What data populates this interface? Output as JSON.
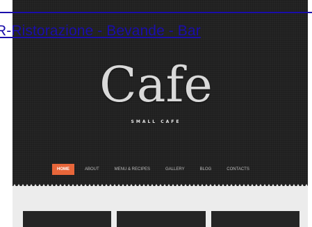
{
  "caption": {
    "text": "R-Ristorazione - Bevande - Bar "
  },
  "site": {
    "logo": "Cafe",
    "tagline": "SMALL CAFE",
    "accent_color": "#e7663a",
    "background_color": "#222222"
  },
  "nav": {
    "items": [
      {
        "label": "HOME",
        "active": true
      },
      {
        "label": "ABOUT",
        "active": false
      },
      {
        "label": "MENU & RECIPES",
        "active": false
      },
      {
        "label": "GALLERY",
        "active": false
      },
      {
        "label": "BLOG",
        "active": false
      },
      {
        "label": "CONTACTS",
        "active": false
      }
    ]
  }
}
